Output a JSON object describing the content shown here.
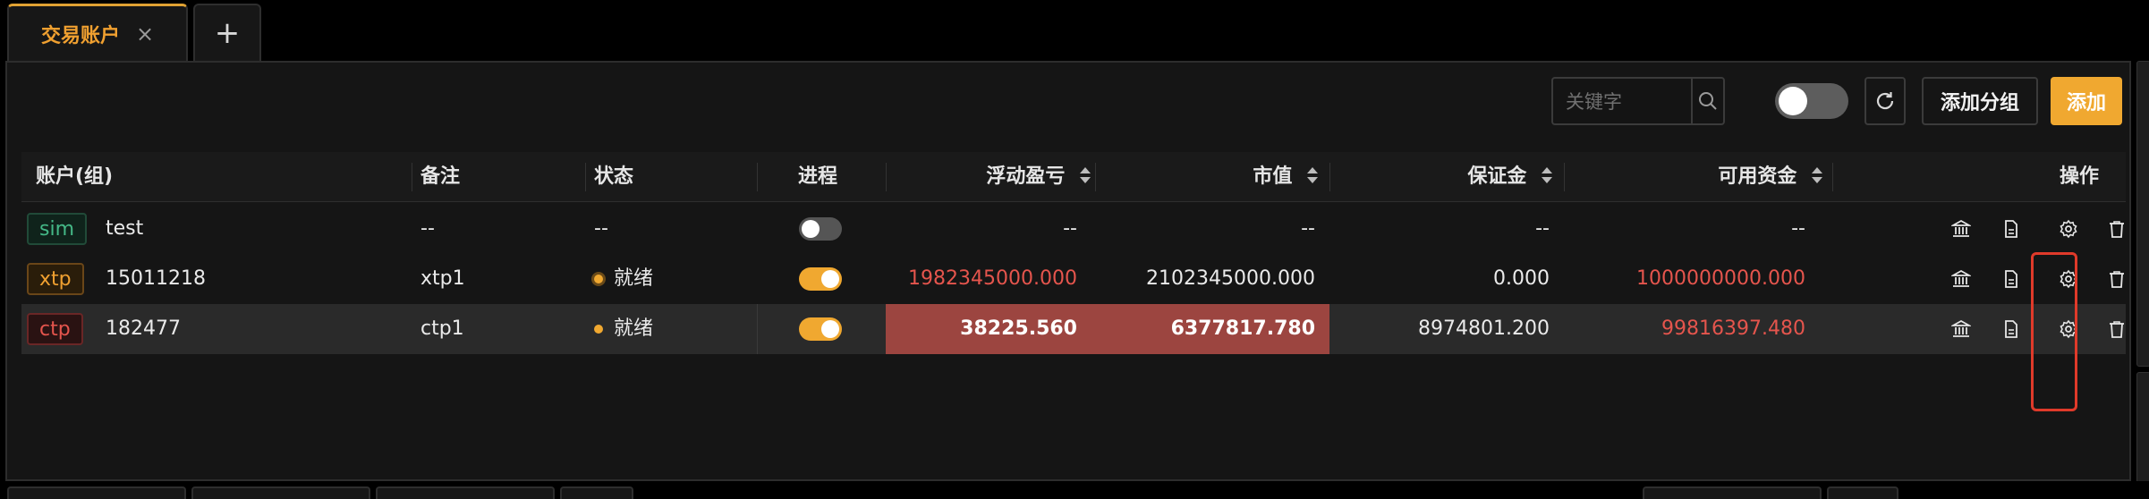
{
  "tabs": {
    "active_label": "交易账户",
    "close_symbol": "×",
    "add_symbol": "+"
  },
  "toolbar": {
    "search_placeholder": "关键字",
    "add_group_label": "添加分组",
    "add_label": "添加"
  },
  "table": {
    "headers": {
      "account": "账户(组)",
      "note": "备注",
      "status": "状态",
      "process": "进程",
      "floating_pnl": "浮动盈亏",
      "market_value": "市值",
      "margin": "保证金",
      "available": "可用资金",
      "actions": "操作"
    },
    "rows": [
      {
        "type": "sim",
        "account": "test",
        "note": "--",
        "status": "--",
        "process_on": false,
        "floating_pnl": "--",
        "market_value": "--",
        "margin": "--",
        "available": "--"
      },
      {
        "type": "xtp",
        "account": "15011218",
        "note": "xtp1",
        "status": "就绪",
        "process_on": true,
        "floating_pnl": "1982345000.000",
        "market_value": "2102345000.000",
        "margin": "0.000",
        "available": "1000000000.000"
      },
      {
        "type": "ctp",
        "account": "182477",
        "note": "ctp1",
        "status": "就绪",
        "process_on": true,
        "floating_pnl": "38225.560",
        "market_value": "6377817.780",
        "margin": "8974801.200",
        "available": "99816397.480"
      }
    ]
  },
  "colors": {
    "accent": "#f0a830",
    "negative": "#e5554d",
    "highlight_cell": "#9c4540",
    "sim_tag": "#44b887"
  },
  "icons": [
    "search-icon",
    "refresh-icon",
    "bank-icon",
    "document-icon",
    "settings-gear-icon",
    "trash-icon",
    "sort-icon",
    "close-icon",
    "plus-icon"
  ]
}
